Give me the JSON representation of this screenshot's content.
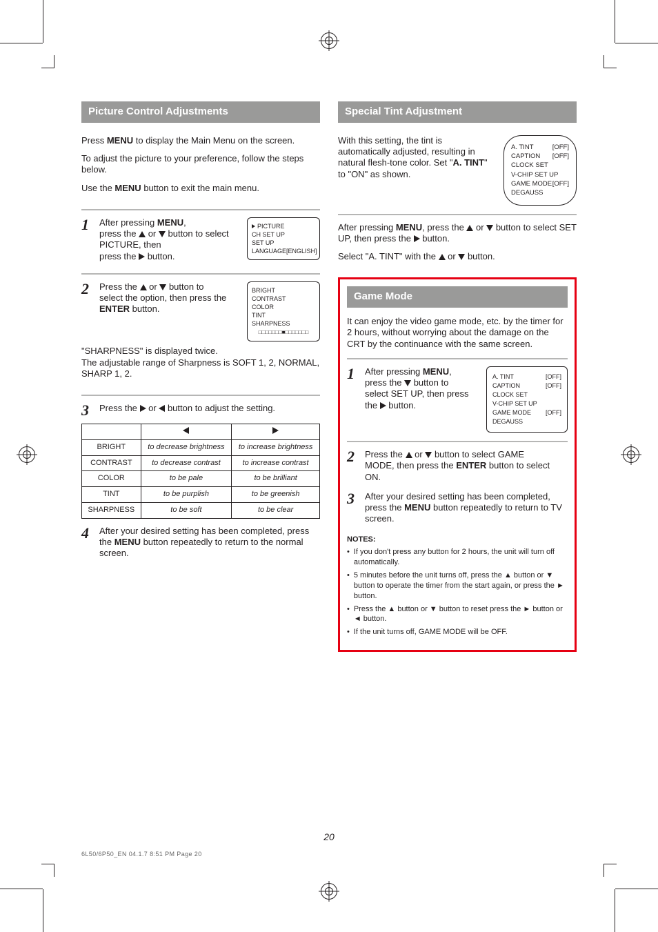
{
  "left": {
    "banner": "Picture Control Adjustments",
    "intro1a": "Press ",
    "intro1b": "MENU",
    "intro1c": " to display the Main Menu on the screen.",
    "intro2": "To adjust the picture to your preference, follow the steps below.",
    "intro3a": "Use the ",
    "intro3b": " button to exit the main menu.",
    "hr1_label": "",
    "step1": {
      "num": "1",
      "main": "After pressing ",
      "menu": "MENU",
      "tail": ",",
      "line2a": "press the ",
      "line2b": " or ",
      "line2c": " button to select",
      "line3": "PICTURE, then",
      "line4a": "press the ",
      "line4b": " button."
    },
    "osd1": {
      "items": [
        {
          "label": "PICTURE",
          "sel": true
        },
        {
          "label": "CH SET UP"
        },
        {
          "label": "SET UP"
        },
        {
          "label": "LANGUAGE",
          "value": "[ENGLISH]"
        }
      ]
    },
    "step2": {
      "num": "2",
      "line1a": "Press the ",
      "line1b": " or ",
      "line1c": " button to",
      "line2": "select the option, then press the",
      "line3a": "ENTER",
      "line3b": " button."
    },
    "osd2": {
      "items": [
        {
          "label": "BRIGHT"
        },
        {
          "label": "CONTRAST"
        },
        {
          "label": "COLOR"
        },
        {
          "label": "TINT"
        },
        {
          "label": "SHARPNESS"
        }
      ],
      "bar": "□□□□□□□■□□□□□□□"
    },
    "note1a": "\"SHARPNESS\" is displayed twice.",
    "note1b": "The adjustable range of Sharpness is SOFT 1, 2, NORMAL, SHARP 1, 2.",
    "step3": {
      "num": "3",
      "line1a": "Press the ",
      "line1b": " or ",
      "line1c": " button to adjust the setting."
    },
    "table": {
      "head": [
        "",
        "◄",
        "►"
      ],
      "rows": [
        [
          "BRIGHT",
          "to decrease brightness",
          "to increase brightness"
        ],
        [
          "CONTRAST",
          "to decrease contrast",
          "to increase contrast"
        ],
        [
          "COLOR",
          "to be pale",
          "to be brilliant"
        ],
        [
          "TINT",
          "to be purplish",
          "to be greenish"
        ],
        [
          "SHARPNESS",
          "to be soft",
          "to be clear"
        ]
      ],
      "ital_footer": ""
    },
    "step4": {
      "num": "4",
      "text": "After your desired setting has been completed, press the ",
      "menu": "MENU",
      "tail": " button repeatedly to return to the normal screen."
    }
  },
  "right": {
    "banner": "Special Tint Adjustment",
    "p1a": "With this setting, the tint is automatically adjusted, resulting in natural flesh-tone color. Set \"",
    "p1b": "A. TINT",
    "p1c": "\" to \"ON\" as shown.",
    "osd_tint": {
      "items": [
        {
          "label": "A. TINT",
          "value": "[OFF]"
        },
        {
          "label": "CAPTION",
          "value": "[OFF]"
        },
        {
          "label": "CLOCK SET"
        },
        {
          "label": "V-CHIP SET UP"
        },
        {
          "label": "GAME MODE",
          "value": "[OFF]"
        },
        {
          "label": "DEGAUSS"
        }
      ]
    },
    "sep_label": "",
    "list_a": "After pressing ",
    "menu": "MENU",
    "list_a2a": ", press the ",
    "list_a2b": " or ",
    "list_a2c": " button to select SET",
    "list_a3a": "UP, then press the ",
    "list_a3b": " button.",
    "list_b1a": "Select \"A. TINT\" with the ",
    "list_b1b": " or ",
    "list_b1c": " button.",
    "red_box": {
      "banner": "Game Mode",
      "p1": "It can enjoy the video game mode, etc. by the timer for 2 hours, without worrying about the damage on the CRT by the continuance with the same screen.",
      "step1": {
        "num": "1",
        "line1a": "After pressing ",
        "menu": "MENU",
        "line1b": ",",
        "line2a": "press the ",
        "line2b": " button to",
        "line3": "select SET UP, then press",
        "line4a": "the ",
        "line4b": " button."
      },
      "osd_setup": {
        "items": [
          {
            "label": "A. TINT",
            "value": "[OFF]"
          },
          {
            "label": "CAPTION",
            "value": "[OFF]"
          },
          {
            "label": "CLOCK SET"
          },
          {
            "label": "V-CHIP SET UP"
          },
          {
            "label": "GAME MODE",
            "value": "[OFF]"
          },
          {
            "label": "DEGAUSS"
          }
        ]
      },
      "step2": {
        "num": "2",
        "line1a": "Press the ",
        "line1b": " or ",
        "line1c": " button to select GAME",
        "line2a": "MODE, then press the ",
        "enter": "ENTER",
        "line2b": " button to select ON."
      },
      "step3": {
        "num": "3",
        "line1a": "After your desired setting has been completed, press the ",
        "menu": "MENU",
        "line1b": " button repeatedly to return to TV screen."
      },
      "notes_title": "NOTES:",
      "notes": [
        "If you don't press any button for 2 hours, the unit will turn off automatically.",
        "5 minutes before the unit turns off, press the ▲ button or ▼ button to operate the timer from the start again, or press the ► button.",
        "Press the ▲ button or ▼ button to reset press the ► button or ◄ button.",
        "If the unit turns off, GAME MODE will be OFF."
      ]
    }
  },
  "page_number": "20",
  "job_line": "6L50/6P50_EN  04.1.7  8:51 PM  Page 20"
}
